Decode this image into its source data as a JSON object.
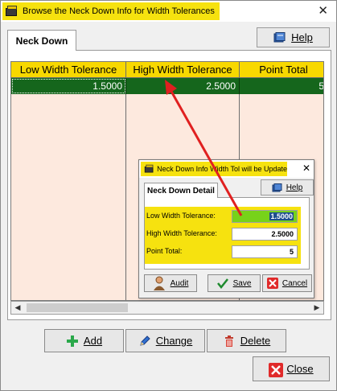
{
  "window": {
    "title": "Browse the Neck Down Info for Width Tolerances",
    "close_glyph": "✕"
  },
  "tab": {
    "label": "Neck Down"
  },
  "help": {
    "label": "Help"
  },
  "grid": {
    "columns": [
      "Low Width Tolerance",
      "High Width Tolerance",
      "Point Total"
    ],
    "rows": [
      {
        "low": "1.5000",
        "high": "2.5000",
        "point_total": "5"
      }
    ],
    "colors": {
      "header_bg": "#f8d800",
      "selected_row_bg": "#15661c",
      "body_bg": "#fde9de"
    }
  },
  "scrollbar": {
    "left_glyph": "◀",
    "right_glyph": "▶"
  },
  "buttons": {
    "add": "Add",
    "change": "Change",
    "delete": "Delete",
    "close": "Close"
  },
  "dialog": {
    "title": "Neck Down Info Width Tol will be Update",
    "close_glyph": "✕",
    "tab": "Neck Down Detail",
    "help": "Help",
    "fields": [
      {
        "label": "Low Width Tolerance:",
        "value": "1.5000"
      },
      {
        "label": "High Width Tolerance:",
        "value": "2.5000"
      },
      {
        "label": "Point Total:",
        "value": "5"
      }
    ],
    "buttons": {
      "audit": "Audit",
      "save": "Save",
      "cancel": "Cancel"
    }
  },
  "annotation": {
    "color": "#e02020",
    "arrow": "red-arrow"
  }
}
